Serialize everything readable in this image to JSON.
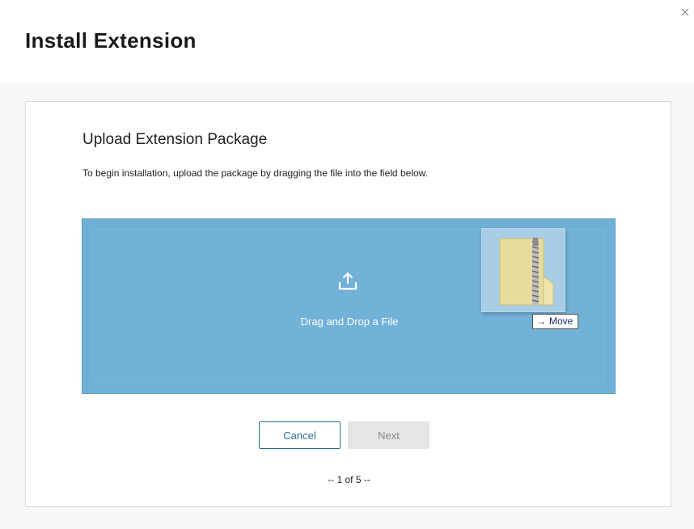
{
  "dialog": {
    "title": "Install Extension",
    "close_icon": "close-icon"
  },
  "step": {
    "heading": "Upload Extension Package",
    "instructions": "To begin installation, upload the package by dragging the file into the field below."
  },
  "dropzone": {
    "label": "Drag and Drop a File",
    "upload_icon": "upload-icon",
    "background_color": "#6fb0d6",
    "drag_ghost_icon": "zip-folder-icon",
    "move_tooltip": "Move"
  },
  "buttons": {
    "cancel": "Cancel",
    "next": "Next"
  },
  "pager": {
    "text": "-- 1 of 5 --"
  }
}
